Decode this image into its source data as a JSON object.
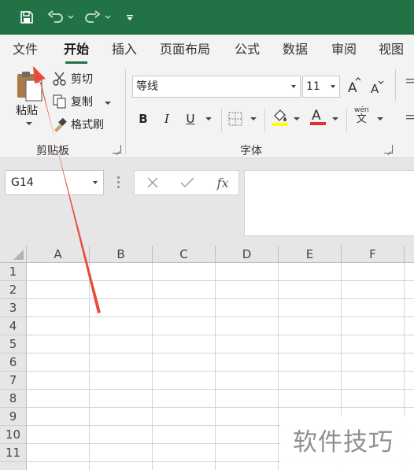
{
  "tabs": [
    "文件",
    "开始",
    "插入",
    "页面布局",
    "公式",
    "数据",
    "审阅",
    "视图"
  ],
  "active_tab": "开始",
  "clipboard": {
    "paste_label": "粘贴",
    "cut_label": "剪切",
    "copy_label": "复制",
    "format_painter_label": "格式刷",
    "group_label": "剪贴板"
  },
  "font": {
    "font_name": "等线",
    "font_size": "11",
    "bold": "B",
    "italic": "I",
    "underline": "U",
    "group_label": "字体",
    "phonetic_icon_text": "wén",
    "phonetic_icon_char": "文"
  },
  "formula_bar": {
    "name_box": "G14",
    "fx_label": "fx"
  },
  "grid": {
    "columns": [
      "A",
      "B",
      "C",
      "D",
      "E",
      "F"
    ],
    "rows": [
      "1",
      "2",
      "3",
      "4",
      "5",
      "6",
      "7",
      "8",
      "9",
      "10",
      "11"
    ]
  },
  "watermark": "软件技巧",
  "colors": {
    "brand": "#217346",
    "fill_color": "#ffff00",
    "font_color": "#e03131",
    "annotation_arrow": "#ea4b3b"
  }
}
